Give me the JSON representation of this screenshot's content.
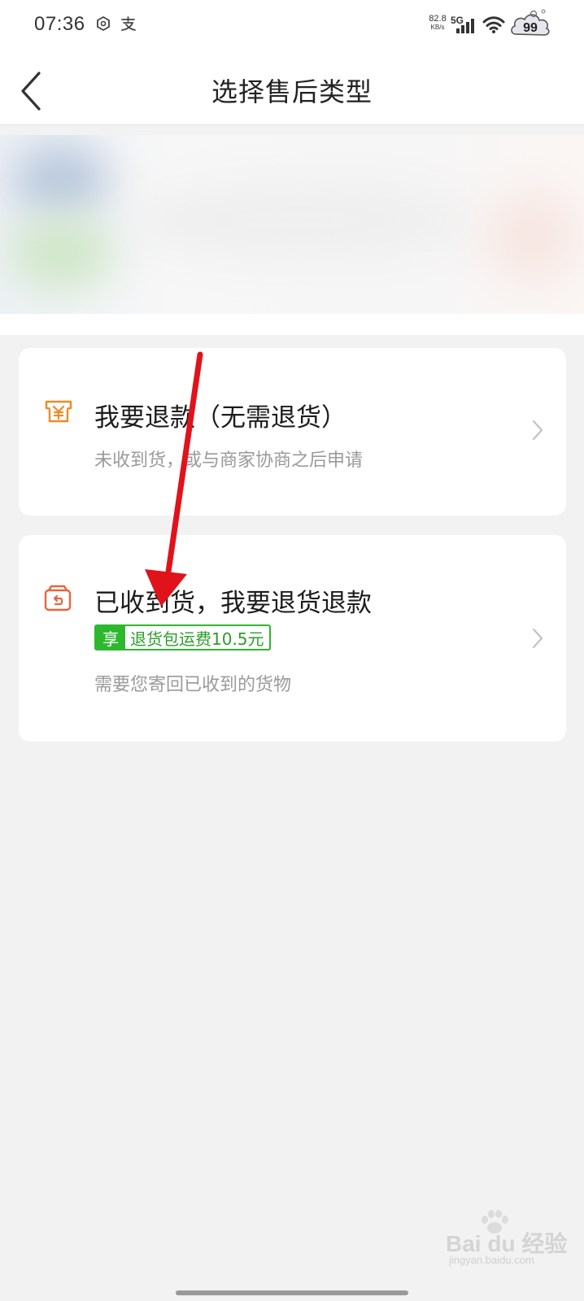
{
  "status_bar": {
    "time": "07:36",
    "net_speed_value": "82.8",
    "net_speed_unit": "KB/s",
    "network_type": "5G",
    "battery_level": "99",
    "left_icons": [
      "app-notification-icon",
      "alipay-icon"
    ]
  },
  "navbar": {
    "title": "选择售后类型",
    "back_icon": "chevron-left-icon"
  },
  "options": [
    {
      "title": "我要退款（无需退货）",
      "subtitle": "未收到货，或与商家协商之后申请",
      "icon": "refund-yuan-icon",
      "accent": "#f08a24"
    },
    {
      "title": "已收到货，我要退货退款",
      "promo_tag": "享",
      "promo_text": "退货包运费10.5元",
      "subtitle": "需要您寄回已收到的货物",
      "icon": "return-box-icon",
      "accent": "#e8643c"
    }
  ],
  "watermark": {
    "main": "Bai du 经验",
    "sub": "jingyan.baidu.com"
  },
  "colors": {
    "page_bg": "#f2f2f2",
    "card_bg": "#ffffff",
    "promo_green": "#2eb82e",
    "annotation_red": "#e0131a"
  }
}
